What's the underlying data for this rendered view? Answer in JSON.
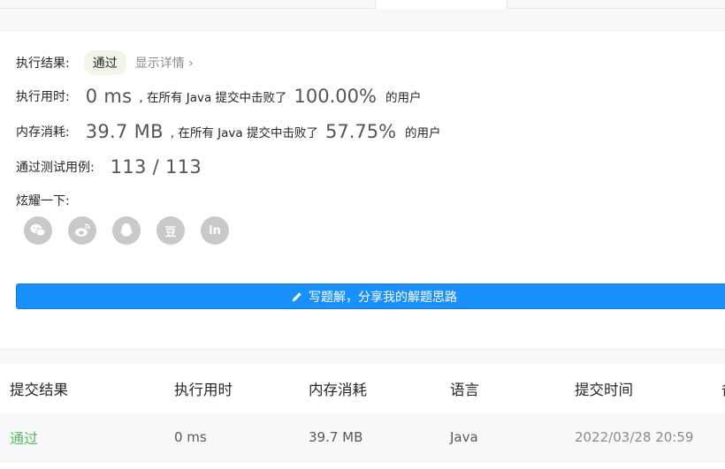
{
  "result": {
    "label": "执行结果:",
    "status": "通过",
    "detail_link": "显示详情 ›"
  },
  "runtime": {
    "label": "执行用时:",
    "value": "0 ms",
    "beat_text": ", 在所有 Java 提交中击败了",
    "percent": "100.00%",
    "users_text": "的用户"
  },
  "memory": {
    "label": "内存消耗:",
    "value": "39.7 MB",
    "beat_text": ", 在所有 Java 提交中击败了",
    "percent": "57.75%",
    "users_text": "的用户"
  },
  "testcases": {
    "label": "通过测试用例:",
    "value": "113 / 113"
  },
  "share": {
    "label": "炫耀一下:",
    "icons": [
      "wechat-icon",
      "weibo-icon",
      "qq-icon",
      "douban-icon",
      "linkedin-icon"
    ],
    "douban_glyph": "豆",
    "linkedin_glyph": "in"
  },
  "write_solution": {
    "label": "写题解，分享我的解题思路"
  },
  "table": {
    "headers": [
      "提交结果",
      "执行用时",
      "内存消耗",
      "语言",
      "提交时间",
      "备"
    ],
    "rows": [
      [
        "通过",
        "0 ms",
        "39.7 MB",
        "Java",
        "2022/03/28 20:59"
      ]
    ]
  },
  "colors": {
    "accent_blue": "#1a90ff",
    "success_green": "#5cb85c",
    "badge_bg": "#f0f6e9",
    "icon_gray": "#c9c9c9"
  }
}
